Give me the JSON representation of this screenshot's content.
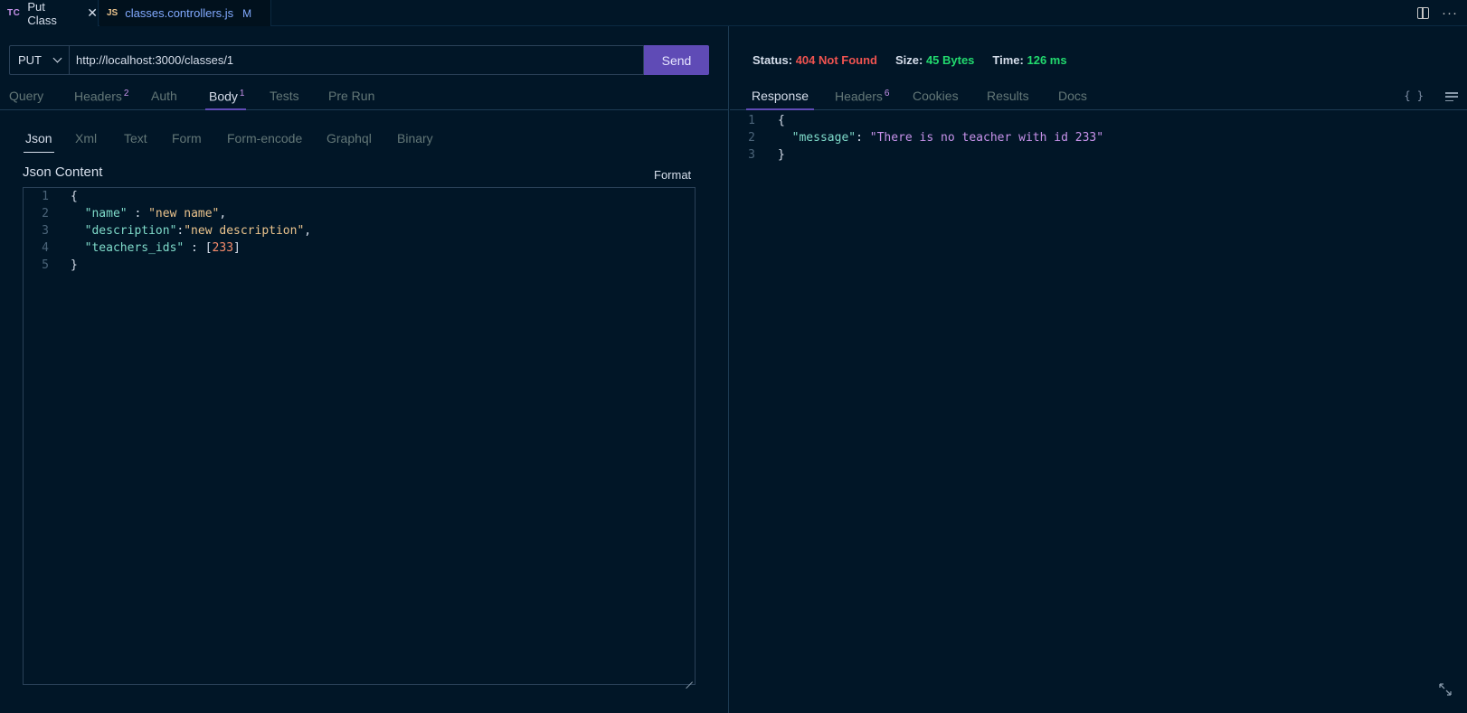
{
  "editor_tabs": [
    {
      "badge": "TC",
      "label": "Put Class",
      "close": "✕"
    },
    {
      "badge": "JS",
      "label": "classes.controllers.js",
      "modified": "M"
    }
  ],
  "request": {
    "method": "PUT",
    "url": "http://localhost:3000/classes/1",
    "send_label": "Send",
    "tabs": [
      {
        "label": "Query"
      },
      {
        "label": "Headers",
        "count": "2"
      },
      {
        "label": "Auth"
      },
      {
        "label": "Body",
        "count": "1"
      },
      {
        "label": "Tests"
      },
      {
        "label": "Pre Run"
      }
    ],
    "body_tabs": [
      "Json",
      "Xml",
      "Text",
      "Form",
      "Form-encode",
      "Graphql",
      "Binary"
    ],
    "json_content_title": "Json Content",
    "format_label": "Format",
    "body_lines": [
      {
        "n": "1",
        "parts": [
          {
            "t": "{",
            "c": "p"
          }
        ]
      },
      {
        "n": "2",
        "parts": [
          {
            "t": "  ",
            "c": "p"
          },
          {
            "t": "\"name\"",
            "c": "k"
          },
          {
            "t": " : ",
            "c": "p"
          },
          {
            "t": "\"new name\"",
            "c": "s"
          },
          {
            "t": ",",
            "c": "p"
          }
        ]
      },
      {
        "n": "3",
        "parts": [
          {
            "t": "  ",
            "c": "p"
          },
          {
            "t": "\"description\"",
            "c": "k"
          },
          {
            "t": ":",
            "c": "p"
          },
          {
            "t": "\"new description\"",
            "c": "s"
          },
          {
            "t": ",",
            "c": "p"
          }
        ]
      },
      {
        "n": "4",
        "parts": [
          {
            "t": "  ",
            "c": "p"
          },
          {
            "t": "\"teachers_ids\"",
            "c": "k"
          },
          {
            "t": " : [",
            "c": "p"
          },
          {
            "t": "233",
            "c": "n"
          },
          {
            "t": "]",
            "c": "p"
          }
        ]
      },
      {
        "n": "5",
        "parts": [
          {
            "t": "}",
            "c": "p"
          }
        ]
      }
    ]
  },
  "response": {
    "status_label": "Status:",
    "status_value": "404 Not Found",
    "size_label": "Size:",
    "size_value": "45 Bytes",
    "time_label": "Time:",
    "time_value": "126 ms",
    "tabs": [
      {
        "label": "Response"
      },
      {
        "label": "Headers",
        "count": "6"
      },
      {
        "label": "Cookies"
      },
      {
        "label": "Results"
      },
      {
        "label": "Docs"
      }
    ],
    "braces_icon": "{ }",
    "lines": [
      {
        "n": "1",
        "parts": [
          {
            "t": "{",
            "c": "p"
          }
        ]
      },
      {
        "n": "2",
        "parts": [
          {
            "t": "  ",
            "c": "p"
          },
          {
            "t": "\"message\"",
            "c": "k"
          },
          {
            "t": ": ",
            "c": "p"
          },
          {
            "t": "\"There is no teacher with id 233\"",
            "c": "msg"
          }
        ]
      },
      {
        "n": "3",
        "parts": [
          {
            "t": "}",
            "c": "p"
          }
        ]
      }
    ]
  },
  "colors": {
    "background": "#011627",
    "accent": "#5f4bb6",
    "error": "#ef5350",
    "success": "#22da6e"
  },
  "icons": [
    "close-icon",
    "split-editor-icon",
    "more-icon",
    "chevron-down-icon",
    "braces-icon",
    "menu-icon",
    "expand-icon"
  ]
}
